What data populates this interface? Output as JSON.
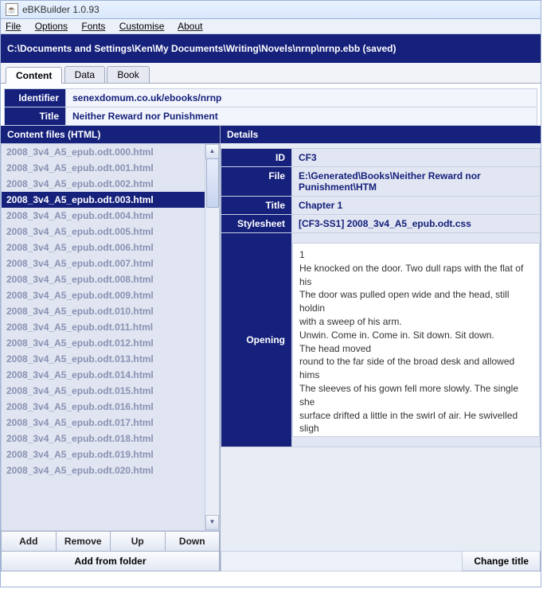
{
  "app_title": "eBKBuilder 1.0.93",
  "menu": [
    "File",
    "Options",
    "Fonts",
    "Customise",
    "About"
  ],
  "pathbar": "C:\\Documents and Settings\\Ken\\My Documents\\Writing\\Novels\\nrnp\\nrnp.ebb (saved)",
  "tabs": [
    {
      "label": "Content",
      "active": true
    },
    {
      "label": "Data",
      "active": false
    },
    {
      "label": "Book",
      "active": false
    }
  ],
  "top_kv": [
    {
      "key": "Identifier",
      "val": "senexdomum.co.uk/ebooks/nrnp"
    },
    {
      "key": "Title",
      "val": "Neither Reward nor Punishment"
    }
  ],
  "left_header": "Content files (HTML)",
  "files": [
    "2008_3v4_A5_epub.odt.000.html",
    "2008_3v4_A5_epub.odt.001.html",
    "2008_3v4_A5_epub.odt.002.html",
    "2008_3v4_A5_epub.odt.003.html",
    "2008_3v4_A5_epub.odt.004.html",
    "2008_3v4_A5_epub.odt.005.html",
    "2008_3v4_A5_epub.odt.006.html",
    "2008_3v4_A5_epub.odt.007.html",
    "2008_3v4_A5_epub.odt.008.html",
    "2008_3v4_A5_epub.odt.009.html",
    "2008_3v4_A5_epub.odt.010.html",
    "2008_3v4_A5_epub.odt.011.html",
    "2008_3v4_A5_epub.odt.012.html",
    "2008_3v4_A5_epub.odt.013.html",
    "2008_3v4_A5_epub.odt.014.html",
    "2008_3v4_A5_epub.odt.015.html",
    "2008_3v4_A5_epub.odt.016.html",
    "2008_3v4_A5_epub.odt.017.html",
    "2008_3v4_A5_epub.odt.018.html",
    "2008_3v4_A5_epub.odt.019.html",
    "2008_3v4_A5_epub.odt.020.html"
  ],
  "selected_index": 3,
  "buttons": {
    "add": "Add",
    "remove": "Remove",
    "up": "Up",
    "down": "Down",
    "add_folder": "Add from folder"
  },
  "right_header": "Details",
  "details": {
    "id_key": "ID",
    "id_val": "CF3",
    "file_key": "File",
    "file_val": "E:\\Generated\\Books\\Neither Reward nor Punishment\\HTM",
    "title_key": "Title",
    "title_val": "Chapter 1",
    "style_key": "Stylesheet",
    "style_val": "[CF3-SS1] 2008_3v4_A5_epub.odt.css",
    "opening_key": "Opening",
    "opening_text": " 1\nHe knocked on the door. Two dull raps with the flat of his\nThe door was pulled open wide and the head, still holdin\nwith a sweep of his arm.\nUnwin. Come in. Come in. Sit down. Sit down.\nThe head moved\nround to the far side of the broad desk and allowed hims\nThe sleeves of his gown fell more slowly. The single she\nsurface drifted a little in the swirl of air. He swivelled sligh\nraised one knee over the other and interlaced his  fingers\nhis suit and leaned back as far as the chair would let hin\n\n..."
  },
  "bottom_button": "Change title"
}
